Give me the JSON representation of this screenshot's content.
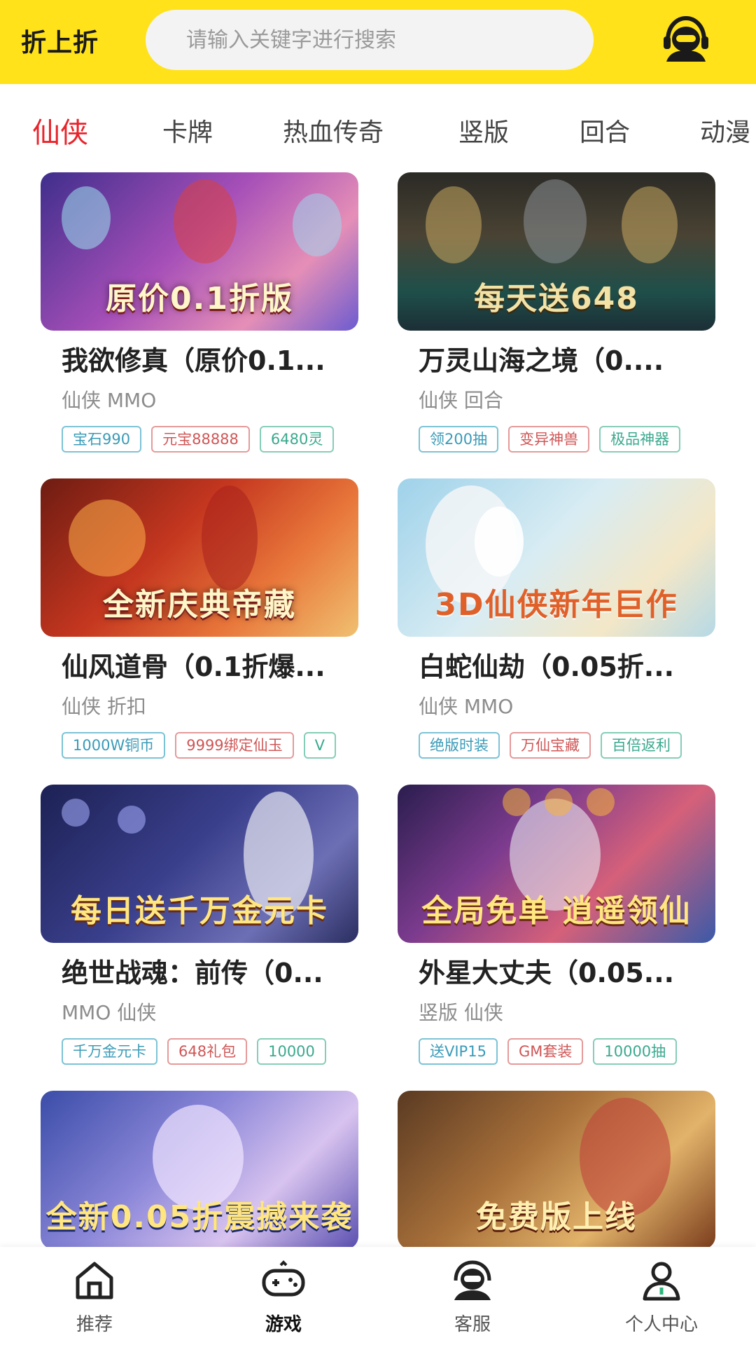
{
  "header": {
    "app_title": "折上折",
    "search_placeholder": "请输入关键字进行搜索",
    "customer_service_icon": "headset-agent-icon"
  },
  "tabs": [
    {
      "label": "仙侠",
      "active": true
    },
    {
      "label": "卡牌",
      "active": false
    },
    {
      "label": "热血传奇",
      "active": false
    },
    {
      "label": "竖版",
      "active": false
    },
    {
      "label": "回合",
      "active": false
    },
    {
      "label": "动漫",
      "active": false
    }
  ],
  "games": [
    {
      "title": "我欲修真（原价0.1...",
      "category": "仙侠 MMO",
      "banner_text": "原价0.1折版",
      "tags": [
        "宝石990",
        "元宝88888",
        "6480灵"
      ]
    },
    {
      "title": "万灵山海之境（0....",
      "category": "仙侠 回合",
      "banner_text": "每天送648",
      "tags": [
        "领200抽",
        "变异神兽",
        "极品神器"
      ]
    },
    {
      "title": "仙风道骨（0.1折爆...",
      "category": "仙侠 折扣",
      "banner_text": "全新庆典帝藏",
      "tags": [
        "1000W铜币",
        "9999绑定仙玉",
        "V"
      ]
    },
    {
      "title": "白蛇仙劫（0.05折...",
      "category": "仙侠 MMO",
      "banner_text": "3D仙侠新年巨作",
      "tags": [
        "绝版时装",
        "万仙宝藏",
        "百倍返利"
      ]
    },
    {
      "title": "绝世战魂：前传（0...",
      "category": "MMO 仙侠",
      "banner_text": "每日送千万金元卡",
      "tags": [
        "千万金元卡",
        "648礼包",
        "10000"
      ]
    },
    {
      "title": "外星大丈夫（0.05...",
      "category": "竖版 仙侠",
      "banner_text": "全局免单 逍遥领仙",
      "tags": [
        "送VIP15",
        "GM套装",
        "10000抽"
      ]
    },
    {
      "title": "",
      "category": "",
      "banner_text": "全新0.05折震撼来袭",
      "tags": []
    },
    {
      "title": "",
      "category": "",
      "banner_text": "免费版上线",
      "tags": []
    }
  ],
  "bottom_nav": [
    {
      "label": "推荐",
      "icon": "home-icon",
      "active": false
    },
    {
      "label": "游戏",
      "icon": "gamepad-icon",
      "active": true
    },
    {
      "label": "客服",
      "icon": "headset-agent-icon",
      "active": false
    },
    {
      "label": "个人中心",
      "icon": "user-profile-icon",
      "active": false
    }
  ],
  "colors": {
    "header_bg": "#ffe21a",
    "active_tab": "#e8242b"
  }
}
